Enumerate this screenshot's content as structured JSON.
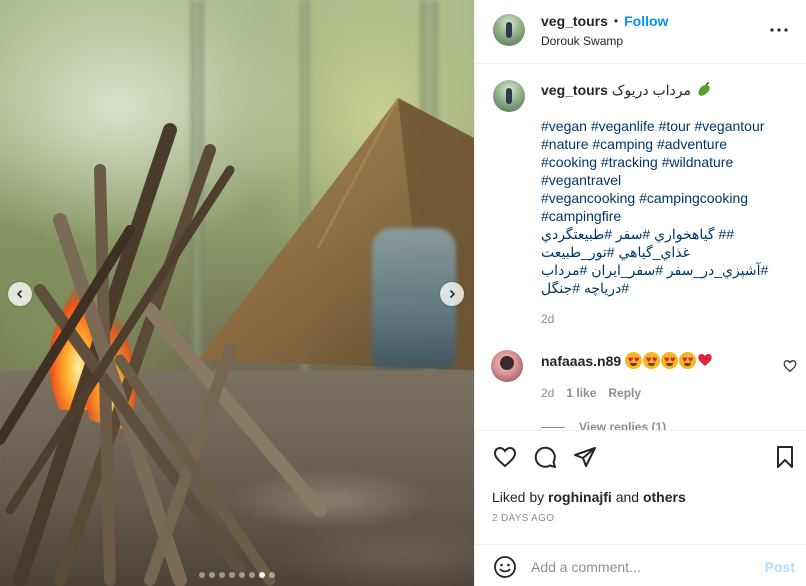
{
  "post": {
    "username": "veg_tours",
    "follow_label": "Follow",
    "separator": "•",
    "location": "Dorouk Swamp"
  },
  "caption": {
    "username": "veg_tours",
    "title": "مرداب دریوک",
    "title_emoji_icon": "eggplant-icon",
    "hashtag_lines": [
      "#vegan #veganlife #tour #vegantour",
      "#nature #camping #adventure",
      "#cooking #tracking #wildnature",
      "#vegantravel",
      "#vegancooking #campingcooking",
      "#campingfire",
      "## گياهخواري #سفر #طبيعتگردي",
      "غذاي_گياهي #تور_طبيعت",
      "#آشپزي_در_سفر #سفر_ايران #مرداب",
      "#درياچه #جنگل"
    ],
    "age": "2d"
  },
  "comment": {
    "username": "nafaaas.n89",
    "emojis": [
      "star-struck-icon",
      "star-struck-icon",
      "star-struck-icon",
      "star-struck-icon",
      "red-heart-icon"
    ],
    "age": "2d",
    "likes": "1 like",
    "reply_label": "Reply",
    "view_replies_label": "View replies (1)"
  },
  "actions": {
    "liked_prefix": "Liked by",
    "liked_user": "roghinajfi",
    "liked_and": "and",
    "liked_others": "others",
    "date": "2 DAYS AGO"
  },
  "add_comment": {
    "placeholder": "Add a comment...",
    "post_label": "Post"
  },
  "carousel": {
    "total_slides": 8,
    "active_index": 6
  },
  "colors": {
    "link_blue": "#0095f6",
    "hashtag_blue": "#00376b",
    "muted_gray": "#8e8e8e",
    "post_disabled": "#b2dffc"
  }
}
